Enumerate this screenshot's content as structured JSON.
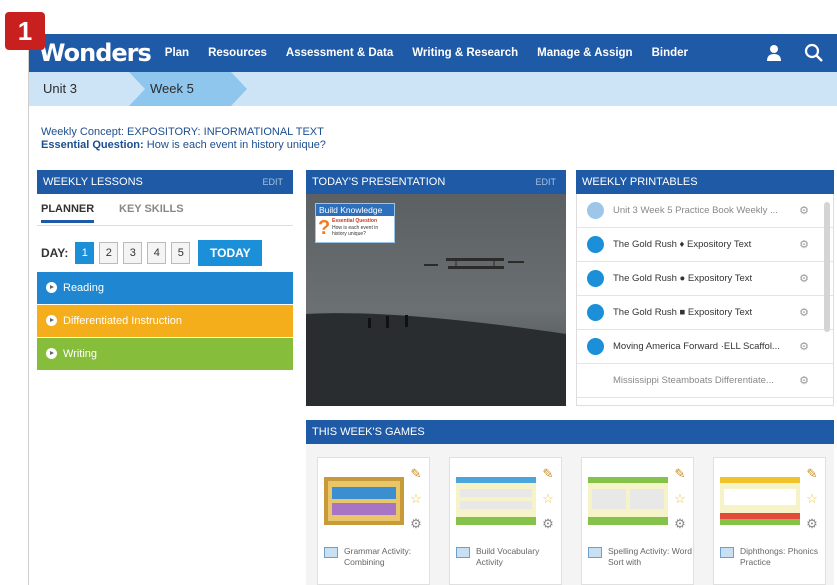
{
  "badge": "1",
  "nav": {
    "logo": "Wonders",
    "items": [
      "Plan",
      "Resources",
      "Assessment & Data",
      "Writing & Research",
      "Manage & Assign",
      "Binder"
    ],
    "icons": [
      "user-icon",
      "search-icon"
    ]
  },
  "breadcrumb": {
    "unit": "Unit 3",
    "week": "Week 5"
  },
  "concept": {
    "concept_label": "Weekly Concept:",
    "concept_value": "EXPOSITORY: INFORMATIONAL TEXT",
    "question_label": "Essential Question:",
    "question_value": "How is each event in history unique?"
  },
  "lessons": {
    "title": "WEEKLY LESSONS",
    "edit": "EDIT",
    "tabs": [
      "PLANNER",
      "KEY SKILLS"
    ],
    "day_label": "DAY:",
    "days": [
      "1",
      "2",
      "3",
      "4",
      "5"
    ],
    "active_day": "1",
    "today": "TODAY",
    "bars": [
      {
        "label": "Reading",
        "color": "#1f86d2"
      },
      {
        "label": "Differentiated Instruction",
        "color": "#f4ae1b"
      },
      {
        "label": "Writing",
        "color": "#86bd3b"
      }
    ]
  },
  "presentation": {
    "title": "TODAY'S PRESENTATION",
    "edit": "EDIT",
    "card_title": "Build Knowledge",
    "card_eq": "Essential Question",
    "card_q": "How is each event in history unique?"
  },
  "printables": {
    "title": "WEEKLY PRINTABLES",
    "items": [
      {
        "label": "Unit 3 Week 5 Practice Book Weekly ...",
        "faded": true
      },
      {
        "label": "The Gold Rush ♦ Expository Text",
        "faded": false
      },
      {
        "label": "The Gold Rush ● Expository Text",
        "faded": false
      },
      {
        "label": "The Gold Rush ■ Expository Text",
        "faded": false
      },
      {
        "label": "Moving America Forward ·ELL Scaffol...",
        "faded": false
      },
      {
        "label": "Mississippi Steamboats Differentiate...",
        "faded": true
      }
    ]
  },
  "games": {
    "title": "THIS WEEK'S GAMES",
    "items": [
      {
        "caption": "Grammar Activity: Combining"
      },
      {
        "caption": "Build Vocabulary Activity"
      },
      {
        "caption": "Spelling Activity: Word Sort with"
      },
      {
        "caption": "Diphthongs: Phonics Practice"
      }
    ]
  }
}
